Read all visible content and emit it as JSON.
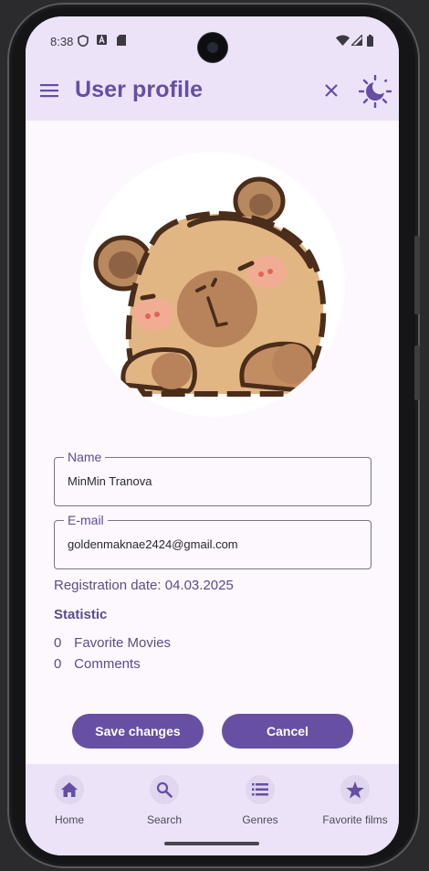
{
  "status_bar": {
    "time": "8:38",
    "icons": [
      "shield-icon",
      "a-badge-icon",
      "sd-card-icon",
      "wifi-icon",
      "signal-icon",
      "battery-icon"
    ]
  },
  "app_bar": {
    "title": "User profile",
    "menu_icon": "menu-icon",
    "close_icon": "close-icon",
    "theme_icon": "dark-mode-icon"
  },
  "profile": {
    "avatar": "capybara-avatar",
    "name_label": "Name",
    "name_value": "MinMin Tranova",
    "email_label": "E-mail",
    "email_value": "goldenmaknae2424@gmail.com",
    "registration": "Registration date: 04.03.2025",
    "statistic_title": "Statistic",
    "stats": [
      {
        "count": "0",
        "label": "Favorite Movies"
      },
      {
        "count": "0",
        "label": "Comments"
      }
    ]
  },
  "actions": {
    "save_label": "Save changes",
    "cancel_label": "Cancel"
  },
  "bottom_nav": {
    "items": [
      {
        "label": "Home",
        "icon": "home-icon"
      },
      {
        "label": "Search",
        "icon": "search-icon"
      },
      {
        "label": "Genres",
        "icon": "list-icon"
      },
      {
        "label": "Favorite films",
        "icon": "star-icon"
      }
    ]
  },
  "colors": {
    "primary": "#6750a4",
    "title": "#654ea3",
    "surface": "#fdf7fe",
    "bar": "#ece3f8"
  }
}
